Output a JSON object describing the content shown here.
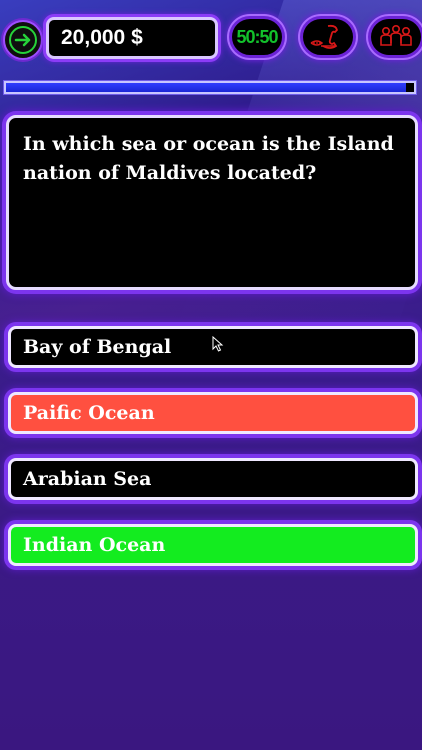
{
  "header": {
    "money": "20,000 $",
    "fifty_fifty_label": "50:50",
    "icons": {
      "back": "back-arrow-icon",
      "fifty": "fifty-fifty-icon",
      "phone": "phone-icon",
      "audience": "audience-icon"
    }
  },
  "progress": {
    "fraction": 0.98
  },
  "question": {
    "text": "In which sea or ocean is the Island nation of Maldives located?"
  },
  "answers": [
    {
      "label": "Bay of Bengal",
      "state": "default"
    },
    {
      "label": "Paific Ocean",
      "state": "wrong"
    },
    {
      "label": "Arabian Sea",
      "state": "default"
    },
    {
      "label": "Indian Ocean",
      "state": "correct"
    }
  ],
  "colors": {
    "accent_purple": "#7c35ee",
    "wrong": "#ff5040",
    "correct": "#13ec1f",
    "progress": "#2f3dff"
  }
}
